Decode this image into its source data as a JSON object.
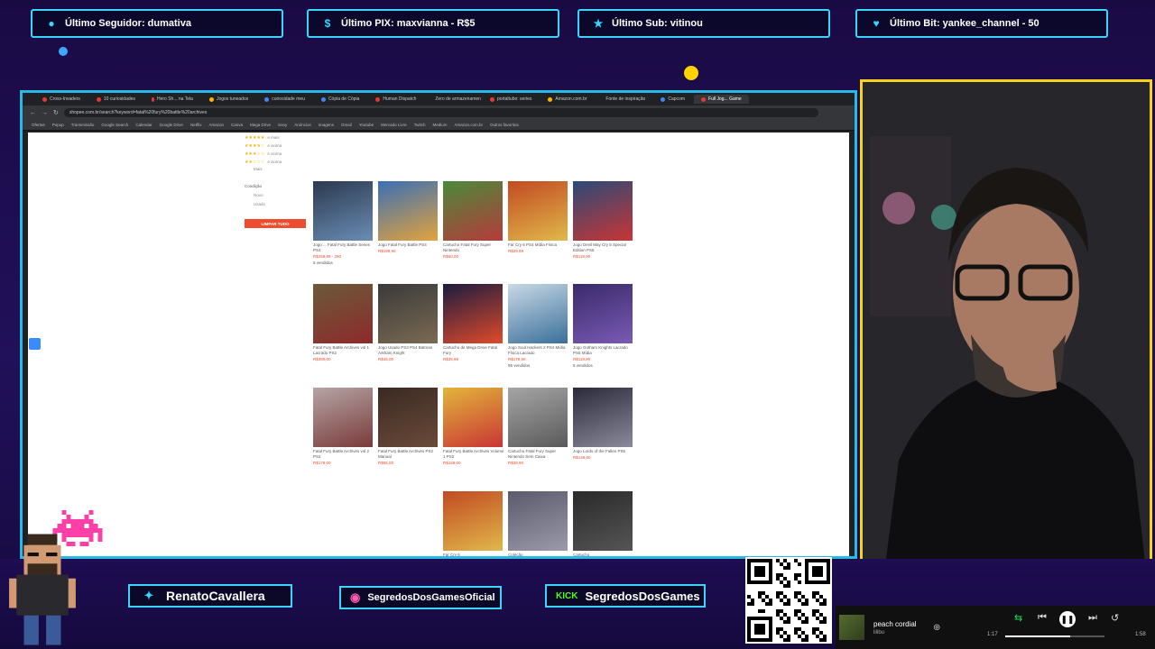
{
  "alerts": [
    {
      "label": "Último Seguidor: dumativa",
      "icon": "user-icon"
    },
    {
      "label": "Último PIX: maxvianna - R$5",
      "icon": "dollar-icon"
    },
    {
      "label": "Último Sub: vitinou",
      "icon": "star-icon"
    },
    {
      "label": "Último Bit: yankee_channel - 50",
      "icon": "heart-gem-icon"
    }
  ],
  "browser": {
    "tabs": [
      "Cross-Invaders",
      "10 curiosidades",
      "Hero Sh... na Tela",
      "Jogos tuneados",
      "curiosidade meu",
      "Cópia de Cópia",
      "Human Dispatch",
      "Zero de armazenamento",
      "portaltubo: series",
      "Amazon.com.br",
      "Fonte de inspiração",
      "Capcom",
      "Full Jog... Game"
    ],
    "active_tab_index": 12,
    "url": "shopee.com.br/search?keyword=fatal%20fury%20battle%20archives",
    "bookmarks": [
      "Ofertas",
      "Popup",
      "Transmissão",
      "Google Search",
      "Calendar",
      "Google Drive",
      "Netflix",
      "Amazon",
      "Canva",
      "Mega Drive",
      "Sony",
      "Anúncios",
      "Imagens",
      "Gmail",
      "Youtube",
      "Mercado Livre",
      "Twitch",
      "Medium",
      "Amazon.com.br",
      "Outros favoritos"
    ],
    "filter": {
      "ratings": [
        "e mais",
        "e acima",
        "e acima",
        "e acima"
      ],
      "more": "Mais",
      "condition_label": "Condição",
      "conditions": [
        "Novo",
        "Usado"
      ],
      "clear_button": "LIMPAR TUDO"
    },
    "products": [
      {
        "title": "Jogo ... Fatal Fury Battle Series PS4",
        "price": "R$259,99 - 290",
        "sold": "5 vendidos",
        "colors": [
          "#2b3a4e",
          "#6a8cb5"
        ]
      },
      {
        "title": "Jogo Fatal Fury Battle PS4",
        "price": "R$199,90",
        "sold": "",
        "colors": [
          "#3a6fb5",
          "#e3a33c"
        ]
      },
      {
        "title": "Cartucho Fatal Fury Super Nintendo",
        "price": "R$60,00",
        "sold": "",
        "colors": [
          "#4a8a3a",
          "#b63b3b"
        ]
      },
      {
        "title": "Far Cry 6 PS4 Mídia Física",
        "price": "R$29,99",
        "sold": "",
        "colors": [
          "#c24a22",
          "#e0b84a"
        ]
      },
      {
        "title": "Jogo Devil May Cry 5 Special Edition PS5",
        "price": "R$119,90",
        "sold": "",
        "colors": [
          "#2a4a78",
          "#c93535"
        ]
      },
      {
        "title": "Fatal Fury Battle Archives vol 1 Lacrado PS2",
        "price": "R$390,00",
        "sold": "",
        "colors": [
          "#6a5a3a",
          "#8e2a2a"
        ]
      },
      {
        "title": "Jogo Usado PS3 PS4 Batman Arkham Knight",
        "price": "R$45,00",
        "sold": "",
        "colors": [
          "#3a3a3a",
          "#7a6a52"
        ]
      },
      {
        "title": "Cartucho de Mega Drive Fatal Fury",
        "price": "R$39,99",
        "sold": "",
        "colors": [
          "#1c1c40",
          "#e04a2a"
        ]
      },
      {
        "title": "Jogo Soul Hackers 2 PS4 Mídia Física Lacrado",
        "price": "R$179,90",
        "sold": "95 vendidos",
        "colors": [
          "#c9d9e6",
          "#3a6f9a"
        ]
      },
      {
        "title": "Jogo Gotham Knights Lacrado PS5 Mídia",
        "price": "R$119,90",
        "sold": "5 vendidos",
        "colors": [
          "#3a2a6a",
          "#7a5ab5"
        ]
      },
      {
        "title": "Fatal Fury Battle Archives vol 2 PS2",
        "price": "R$179,00",
        "sold": "",
        "colors": [
          "#b5a5a5",
          "#7a3a3a"
        ]
      },
      {
        "title": "Fatal Fury Battle Archives PS2 Manual",
        "price": "R$55,00",
        "sold": "",
        "colors": [
          "#3a2a22",
          "#6a4a3a"
        ]
      },
      {
        "title": "Fatal Fury Battle Archives Volume 1 PS2",
        "price": "R$159,00",
        "sold": "",
        "colors": [
          "#e3b53a",
          "#c93535"
        ]
      },
      {
        "title": "Cartucho Fatal Fury Super Nintendo Sem Caixa",
        "price": "R$39,90",
        "sold": "",
        "colors": [
          "#a5a5a5",
          "#5a5a5a"
        ]
      },
      {
        "title": "Jogo Lords of the Fallen PS5",
        "price": "R$149,90",
        "sold": "",
        "colors": [
          "#2a2a3a",
          "#8a8a9a"
        ]
      },
      {
        "title": "Far Cry 6",
        "price": "",
        "sold": "",
        "colors": [
          "#c24a22",
          "#e0b84a"
        ]
      },
      {
        "title": "Coleção",
        "price": "",
        "sold": "",
        "colors": [
          "#5a5a6a",
          "#9a9aaa"
        ]
      },
      {
        "title": "Cartucho",
        "price": "",
        "sold": "",
        "colors": [
          "#2a2a2a",
          "#555555"
        ]
      }
    ]
  },
  "socials": [
    {
      "handle": "RenatoCavallera",
      "icon": "twitter-bird-icon"
    },
    {
      "handle": "SegredosDosGamesOficial",
      "icon": "instagram-icon"
    },
    {
      "handle": "SegredosDosGames",
      "icon": "kick-icon",
      "icon_text": "KICK"
    }
  ],
  "qr_url": "livepix.gg/segredosdosgames",
  "player": {
    "track": "peach cordial",
    "artist": "lilibu",
    "elapsed": "1:17",
    "duration": "1:58",
    "progress": 0.65
  },
  "colors": {
    "accent_cyan": "#3ad5ff",
    "cam_border": "#f6d21c",
    "shopee_orange": "#ee4d2d"
  }
}
